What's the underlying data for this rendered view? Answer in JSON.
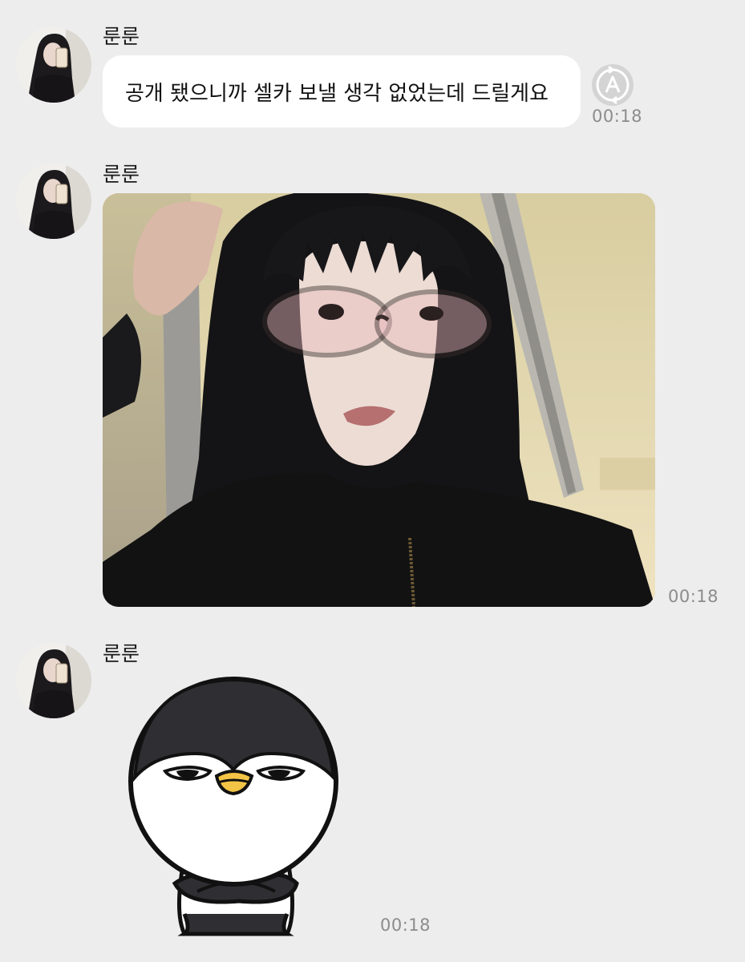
{
  "messages": [
    {
      "sender": "룬룬",
      "type": "text",
      "text": "공개 됐으니까 셀카 보낼 생각 없었는데 드릴게요",
      "time": "00:18",
      "icons": [
        "translate-icon"
      ]
    },
    {
      "sender": "룬룬",
      "type": "photo",
      "time": "00:18",
      "icons": [
        "selfie-photo"
      ]
    },
    {
      "sender": "룬룬",
      "type": "sticker",
      "time": "00:18",
      "icons": [
        "penguin-sticker"
      ]
    }
  ],
  "colors": {
    "background": "#ededed",
    "bubble": "#ffffff",
    "timestamp": "#8c8c8c"
  }
}
